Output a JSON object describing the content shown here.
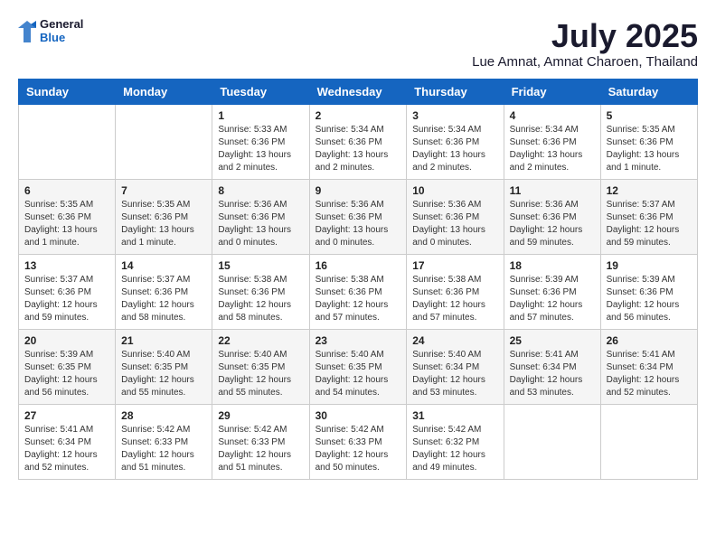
{
  "header": {
    "logo_general": "General",
    "logo_blue": "Blue",
    "month_title": "July 2025",
    "location": "Lue Amnat, Amnat Charoen, Thailand"
  },
  "weekdays": [
    "Sunday",
    "Monday",
    "Tuesday",
    "Wednesday",
    "Thursday",
    "Friday",
    "Saturday"
  ],
  "weeks": [
    [
      {
        "day": "",
        "info": ""
      },
      {
        "day": "",
        "info": ""
      },
      {
        "day": "1",
        "info": "Sunrise: 5:33 AM\nSunset: 6:36 PM\nDaylight: 13 hours and 2 minutes."
      },
      {
        "day": "2",
        "info": "Sunrise: 5:34 AM\nSunset: 6:36 PM\nDaylight: 13 hours and 2 minutes."
      },
      {
        "day": "3",
        "info": "Sunrise: 5:34 AM\nSunset: 6:36 PM\nDaylight: 13 hours and 2 minutes."
      },
      {
        "day": "4",
        "info": "Sunrise: 5:34 AM\nSunset: 6:36 PM\nDaylight: 13 hours and 2 minutes."
      },
      {
        "day": "5",
        "info": "Sunrise: 5:35 AM\nSunset: 6:36 PM\nDaylight: 13 hours and 1 minute."
      }
    ],
    [
      {
        "day": "6",
        "info": "Sunrise: 5:35 AM\nSunset: 6:36 PM\nDaylight: 13 hours and 1 minute."
      },
      {
        "day": "7",
        "info": "Sunrise: 5:35 AM\nSunset: 6:36 PM\nDaylight: 13 hours and 1 minute."
      },
      {
        "day": "8",
        "info": "Sunrise: 5:36 AM\nSunset: 6:36 PM\nDaylight: 13 hours and 0 minutes."
      },
      {
        "day": "9",
        "info": "Sunrise: 5:36 AM\nSunset: 6:36 PM\nDaylight: 13 hours and 0 minutes."
      },
      {
        "day": "10",
        "info": "Sunrise: 5:36 AM\nSunset: 6:36 PM\nDaylight: 13 hours and 0 minutes."
      },
      {
        "day": "11",
        "info": "Sunrise: 5:36 AM\nSunset: 6:36 PM\nDaylight: 12 hours and 59 minutes."
      },
      {
        "day": "12",
        "info": "Sunrise: 5:37 AM\nSunset: 6:36 PM\nDaylight: 12 hours and 59 minutes."
      }
    ],
    [
      {
        "day": "13",
        "info": "Sunrise: 5:37 AM\nSunset: 6:36 PM\nDaylight: 12 hours and 59 minutes."
      },
      {
        "day": "14",
        "info": "Sunrise: 5:37 AM\nSunset: 6:36 PM\nDaylight: 12 hours and 58 minutes."
      },
      {
        "day": "15",
        "info": "Sunrise: 5:38 AM\nSunset: 6:36 PM\nDaylight: 12 hours and 58 minutes."
      },
      {
        "day": "16",
        "info": "Sunrise: 5:38 AM\nSunset: 6:36 PM\nDaylight: 12 hours and 57 minutes."
      },
      {
        "day": "17",
        "info": "Sunrise: 5:38 AM\nSunset: 6:36 PM\nDaylight: 12 hours and 57 minutes."
      },
      {
        "day": "18",
        "info": "Sunrise: 5:39 AM\nSunset: 6:36 PM\nDaylight: 12 hours and 57 minutes."
      },
      {
        "day": "19",
        "info": "Sunrise: 5:39 AM\nSunset: 6:36 PM\nDaylight: 12 hours and 56 minutes."
      }
    ],
    [
      {
        "day": "20",
        "info": "Sunrise: 5:39 AM\nSunset: 6:35 PM\nDaylight: 12 hours and 56 minutes."
      },
      {
        "day": "21",
        "info": "Sunrise: 5:40 AM\nSunset: 6:35 PM\nDaylight: 12 hours and 55 minutes."
      },
      {
        "day": "22",
        "info": "Sunrise: 5:40 AM\nSunset: 6:35 PM\nDaylight: 12 hours and 55 minutes."
      },
      {
        "day": "23",
        "info": "Sunrise: 5:40 AM\nSunset: 6:35 PM\nDaylight: 12 hours and 54 minutes."
      },
      {
        "day": "24",
        "info": "Sunrise: 5:40 AM\nSunset: 6:34 PM\nDaylight: 12 hours and 53 minutes."
      },
      {
        "day": "25",
        "info": "Sunrise: 5:41 AM\nSunset: 6:34 PM\nDaylight: 12 hours and 53 minutes."
      },
      {
        "day": "26",
        "info": "Sunrise: 5:41 AM\nSunset: 6:34 PM\nDaylight: 12 hours and 52 minutes."
      }
    ],
    [
      {
        "day": "27",
        "info": "Sunrise: 5:41 AM\nSunset: 6:34 PM\nDaylight: 12 hours and 52 minutes."
      },
      {
        "day": "28",
        "info": "Sunrise: 5:42 AM\nSunset: 6:33 PM\nDaylight: 12 hours and 51 minutes."
      },
      {
        "day": "29",
        "info": "Sunrise: 5:42 AM\nSunset: 6:33 PM\nDaylight: 12 hours and 51 minutes."
      },
      {
        "day": "30",
        "info": "Sunrise: 5:42 AM\nSunset: 6:33 PM\nDaylight: 12 hours and 50 minutes."
      },
      {
        "day": "31",
        "info": "Sunrise: 5:42 AM\nSunset: 6:32 PM\nDaylight: 12 hours and 49 minutes."
      },
      {
        "day": "",
        "info": ""
      },
      {
        "day": "",
        "info": ""
      }
    ]
  ]
}
